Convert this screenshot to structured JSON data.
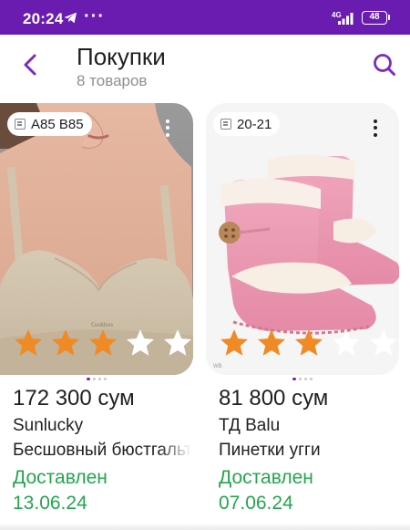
{
  "status_bar": {
    "time": "20:24",
    "network": "4G",
    "battery": "48",
    "notification_dots": "···"
  },
  "header": {
    "title": "Покупки",
    "subtitle": "8 товаров"
  },
  "colors": {
    "accent": "#6a1bb0",
    "delivered": "#23a64e",
    "star_filled": "#f08a24",
    "star_empty": "#ffffff"
  },
  "products": [
    {
      "size": "A85 B85",
      "rating": 3,
      "max_rating": 5,
      "price": "172 300 сум",
      "brand": "Sunlucky",
      "name": "Бесшовный бюстгальтер",
      "status": "Доставлен",
      "date": "13.06.24",
      "image_label": "Goddess"
    },
    {
      "size": "20-21",
      "rating": 3,
      "max_rating": 5,
      "price": "81 800 сум",
      "brand": "ТД Balu",
      "name": "Пинетки угги",
      "status": "Доставлен",
      "date": "07.06.24",
      "image_label": "WB"
    }
  ]
}
